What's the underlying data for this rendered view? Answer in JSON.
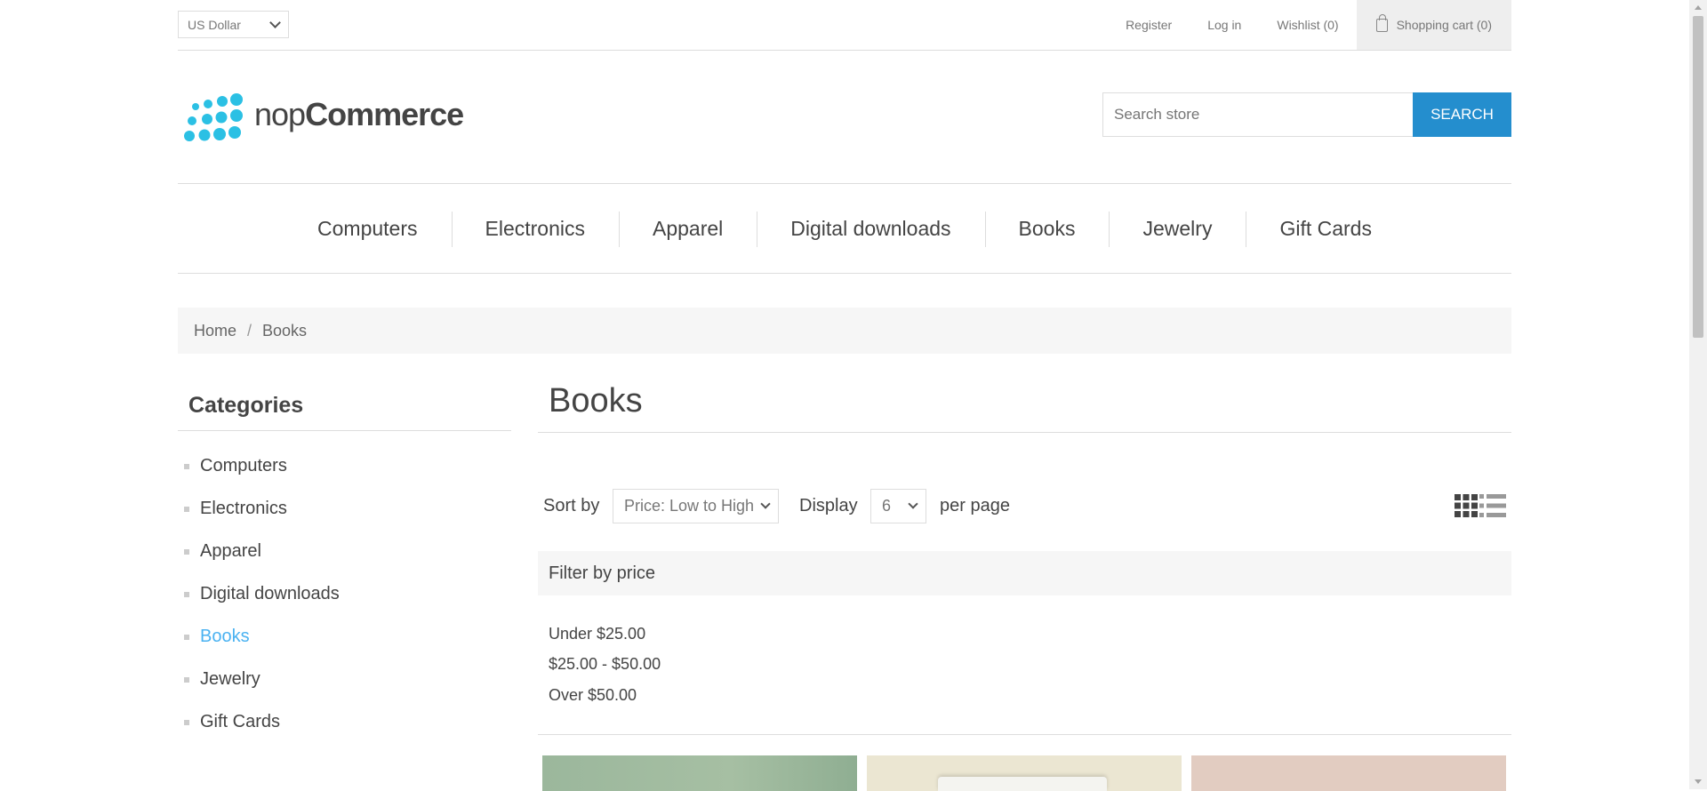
{
  "header": {
    "currency": "US Dollar",
    "links": {
      "register": "Register",
      "login": "Log in",
      "wishlist": "Wishlist (0)",
      "cart": "Shopping cart (0)"
    }
  },
  "logo": {
    "prefix": "nop",
    "suffix": "Commerce"
  },
  "search": {
    "placeholder": "Search store",
    "button": "SEARCH"
  },
  "menu": [
    "Computers",
    "Electronics",
    "Apparel",
    "Digital downloads",
    "Books",
    "Jewelry",
    "Gift Cards"
  ],
  "breadcrumb": {
    "home": "Home",
    "separator": "/",
    "current": "Books"
  },
  "sidebar": {
    "title": "Categories",
    "items": [
      "Computers",
      "Electronics",
      "Apparel",
      "Digital downloads",
      "Books",
      "Jewelry",
      "Gift Cards"
    ],
    "active": "Books"
  },
  "main": {
    "title": "Books",
    "sort_label": "Sort by",
    "sort_value": "Price: Low to High",
    "display_label": "Display",
    "display_value": "6",
    "per_page_label": "per page",
    "filter": {
      "title": "Filter by price",
      "options": [
        "Under $25.00",
        "$25.00 - $50.00",
        "Over $50.00"
      ]
    }
  },
  "colors": {
    "accent": "#4ab2f1",
    "search_button": "#248ece",
    "logo_dots": "#2bc0e4"
  }
}
